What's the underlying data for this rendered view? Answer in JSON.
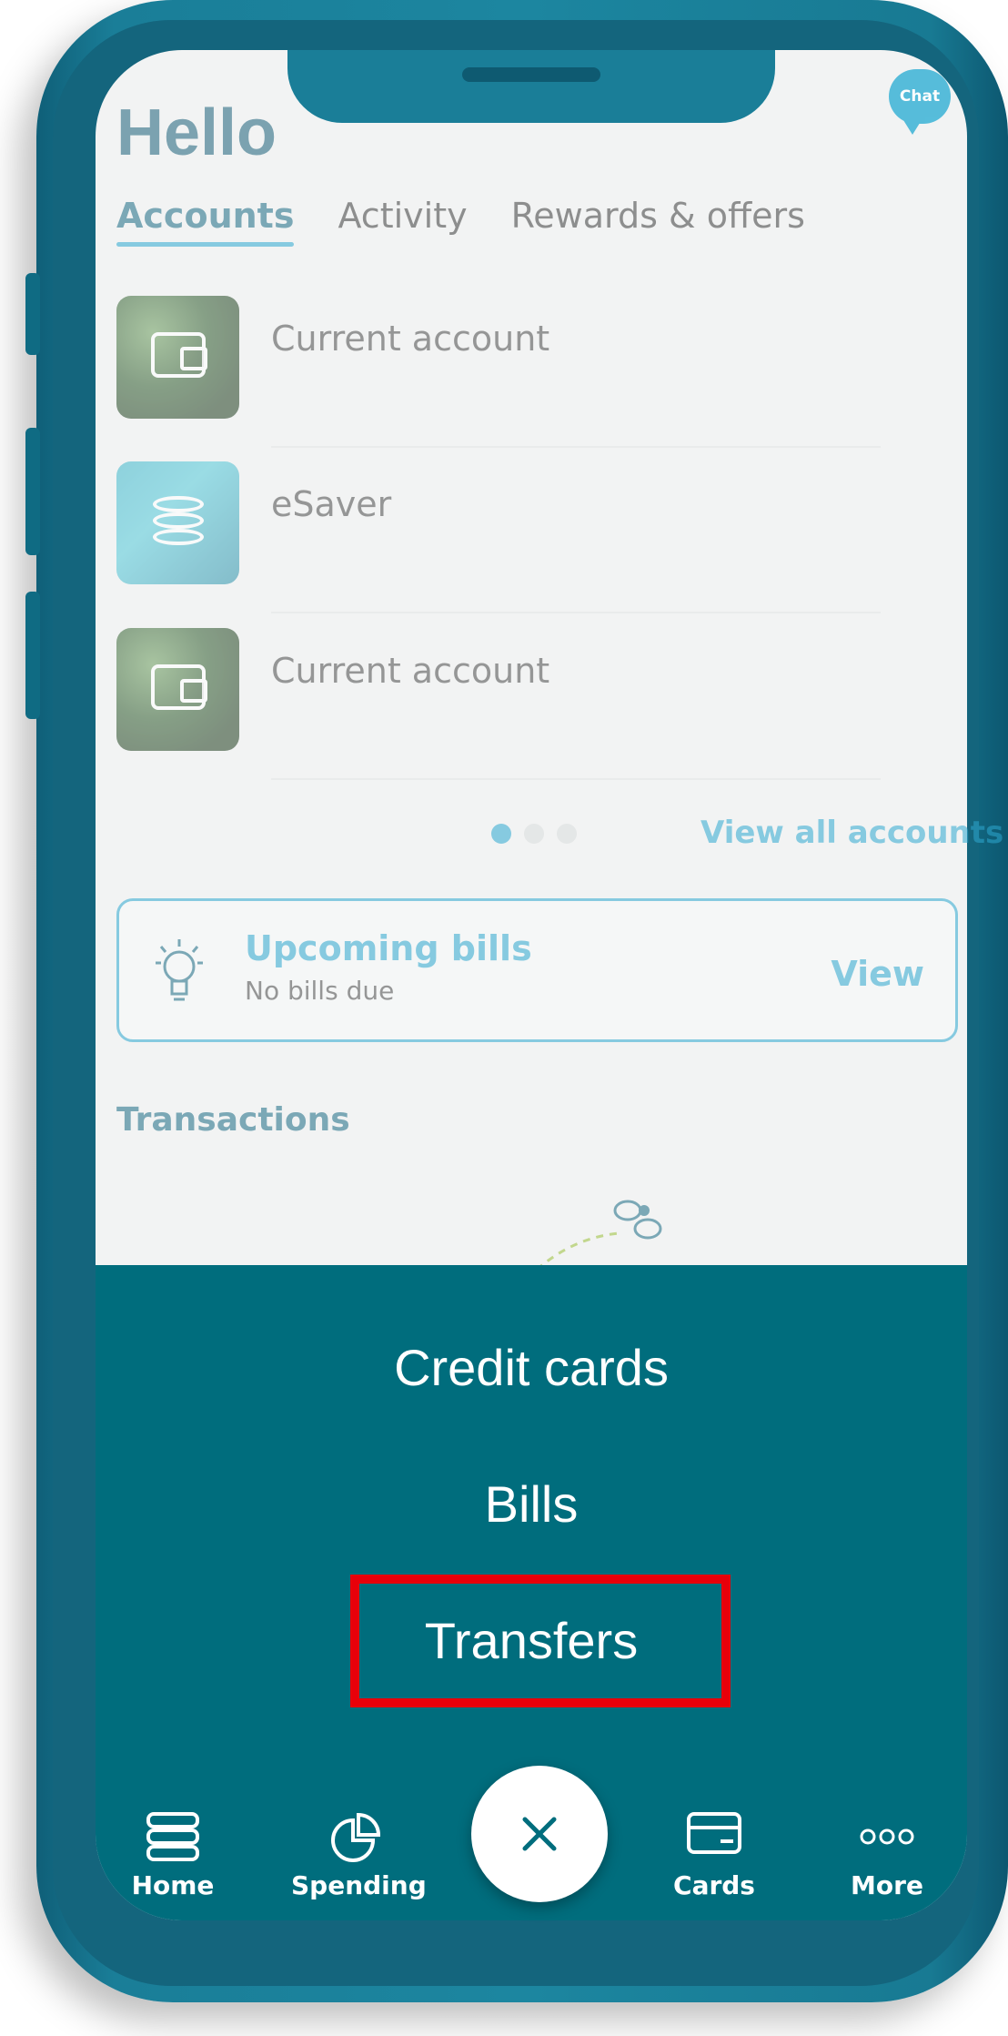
{
  "app": {
    "greeting": "Hello",
    "chat_label": "Chat"
  },
  "tabs": [
    {
      "label": "Accounts",
      "active": true
    },
    {
      "label": "Activity",
      "active": false
    },
    {
      "label": "Rewards & offers",
      "active": false
    }
  ],
  "accounts": [
    {
      "name": "Current account",
      "thumb": "wallet-icon"
    },
    {
      "name": "eSaver",
      "thumb": "coins-icon"
    },
    {
      "name": "Current account",
      "thumb": "wallet-icon"
    }
  ],
  "pager": {
    "pages": 3,
    "current": 1
  },
  "view_all_accounts": "View all accounts",
  "bills": {
    "title": "Upcoming bills",
    "subtitle": "No bills due",
    "action": "View",
    "icon": "lightbulb-icon"
  },
  "transactions_label": "Transactions",
  "menu": {
    "items": [
      {
        "label": "Credit cards"
      },
      {
        "label": "Bills"
      },
      {
        "label": "Transfers",
        "highlighted": true
      }
    ]
  },
  "bottom_nav": {
    "home": "Home",
    "spending": "Spending",
    "cards": "Cards",
    "more": "More",
    "close_icon": "close-icon"
  },
  "colors": {
    "phone": "#1a7e98",
    "overlay": "#006d7d",
    "accent": "#2ea8cf",
    "highlight": "#e8000a"
  }
}
